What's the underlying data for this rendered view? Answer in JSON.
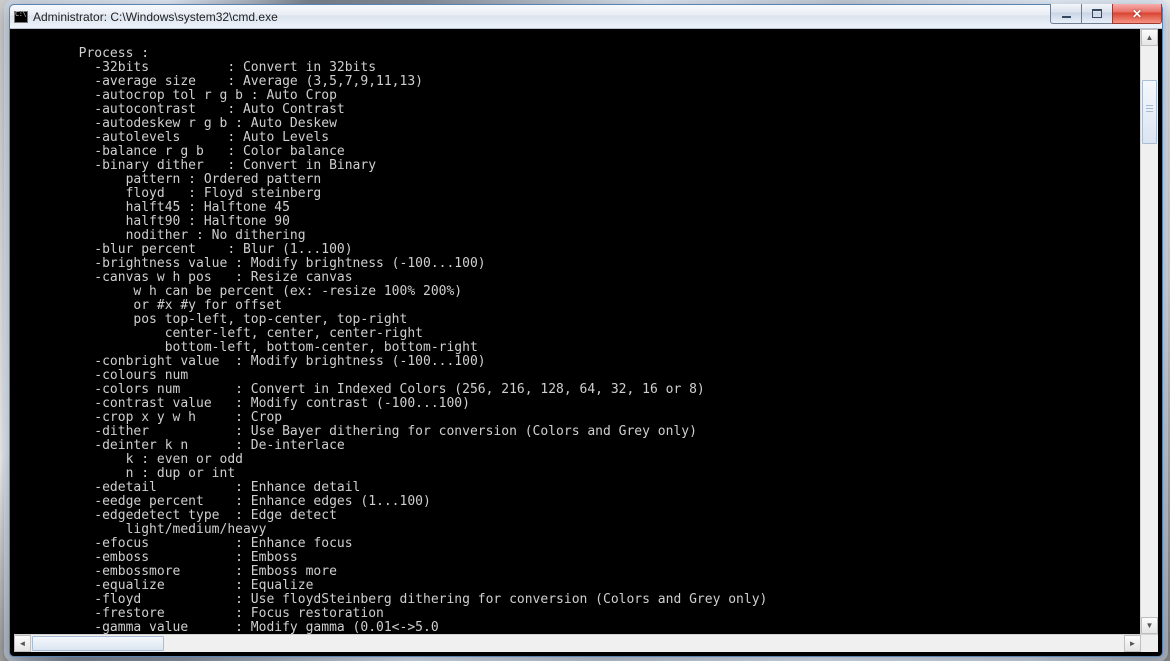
{
  "window": {
    "title": "Administrator: C:\\Windows\\system32\\cmd.exe"
  },
  "terminal_lines": [
    "",
    "        Process :",
    "          -32bits          : Convert in 32bits",
    "          -average size    : Average (3,5,7,9,11,13)",
    "          -autocrop tol r g b : Auto Crop",
    "          -autocontrast    : Auto Contrast",
    "          -autodeskew r g b : Auto Deskew",
    "          -autolevels      : Auto Levels",
    "          -balance r g b   : Color balance",
    "          -binary dither   : Convert in Binary",
    "              pattern : Ordered pattern",
    "              floyd   : Floyd steinberg",
    "              halft45 : Halftone 45",
    "              halft90 : Halftone 90",
    "              nodither : No dithering",
    "          -blur percent    : Blur (1...100)",
    "          -brightness value : Modify brightness (-100...100)",
    "          -canvas w h pos   : Resize canvas",
    "               w h can be percent (ex: -resize 100% 200%)",
    "               or #x #y for offset",
    "               pos top-left, top-center, top-right",
    "                   center-left, center, center-right",
    "                   bottom-left, bottom-center, bottom-right",
    "          -conbright value  : Modify brightness (-100...100)",
    "          -colours num",
    "          -colors num       : Convert in Indexed Colors (256, 216, 128, 64, 32, 16 or 8)",
    "          -contrast value   : Modify contrast (-100...100)",
    "          -crop x y w h     : Crop",
    "          -dither           : Use Bayer dithering for conversion (Colors and Grey only)",
    "          -deinter k n      : De-interlace",
    "              k : even or odd",
    "              n : dup or int",
    "          -edetail          : Enhance detail",
    "          -eedge percent    : Enhance edges (1...100)",
    "          -edgedetect type  : Edge detect",
    "              light/medium/heavy",
    "          -efocus           : Enhance focus",
    "          -emboss           : Emboss",
    "          -embossmore       : Emboss more",
    "          -equalize         : Equalize",
    "          -floyd            : Use floydSteinberg dithering for conversion (Colors and Grey only)",
    "          -frestore         : Focus restoration",
    "          -gamma value      : Modify gamma (0.01<->5.0"
  ]
}
